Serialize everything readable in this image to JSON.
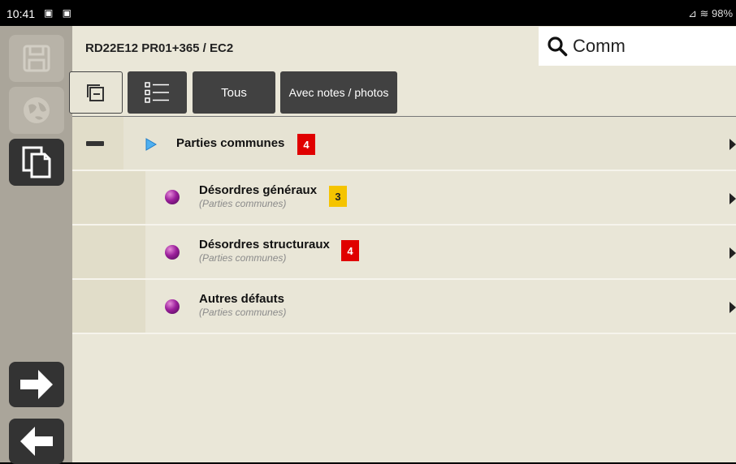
{
  "status_bar": {
    "time": "10:41",
    "left_icons": "▣ ▣",
    "right_text": "⊿ ≋ 98%"
  },
  "sidebar": {
    "buttons": [
      {
        "name": "save",
        "icon": "save-icon",
        "enabled": false
      },
      {
        "name": "globe",
        "icon": "globe-icon",
        "enabled": false
      },
      {
        "name": "copy",
        "icon": "copy-icon",
        "enabled": true
      },
      {
        "name": "next",
        "icon": "arrow-right-icon",
        "enabled": true
      },
      {
        "name": "back",
        "icon": "arrow-left-icon",
        "enabled": true
      }
    ]
  },
  "header": {
    "title": "RD22E12 PR01+365 / EC2"
  },
  "search": {
    "value": "Comm"
  },
  "toolbar": {
    "tous_label": "Tous",
    "notes_label": "Avec notes / photos"
  },
  "tree": {
    "group": {
      "title": "Parties communes",
      "count": "4",
      "badge_color": "#e00000"
    },
    "items": [
      {
        "title": "Désordres généraux",
        "subtitle": "(Parties communes)",
        "count": "3",
        "badge_color": "#f5c400"
      },
      {
        "title": "Désordres structuraux",
        "subtitle": "(Parties communes)",
        "count": "4",
        "badge_color": "#e00000"
      },
      {
        "title": "Autres défauts",
        "subtitle": "(Parties communes)",
        "count": ""
      }
    ]
  },
  "colors": {
    "background": "#eae7d8",
    "sidebar": "#aaa59a",
    "button_dark": "#414141",
    "accent_blue": "#2a9df4",
    "orb_purple": "#9b1f9b"
  }
}
